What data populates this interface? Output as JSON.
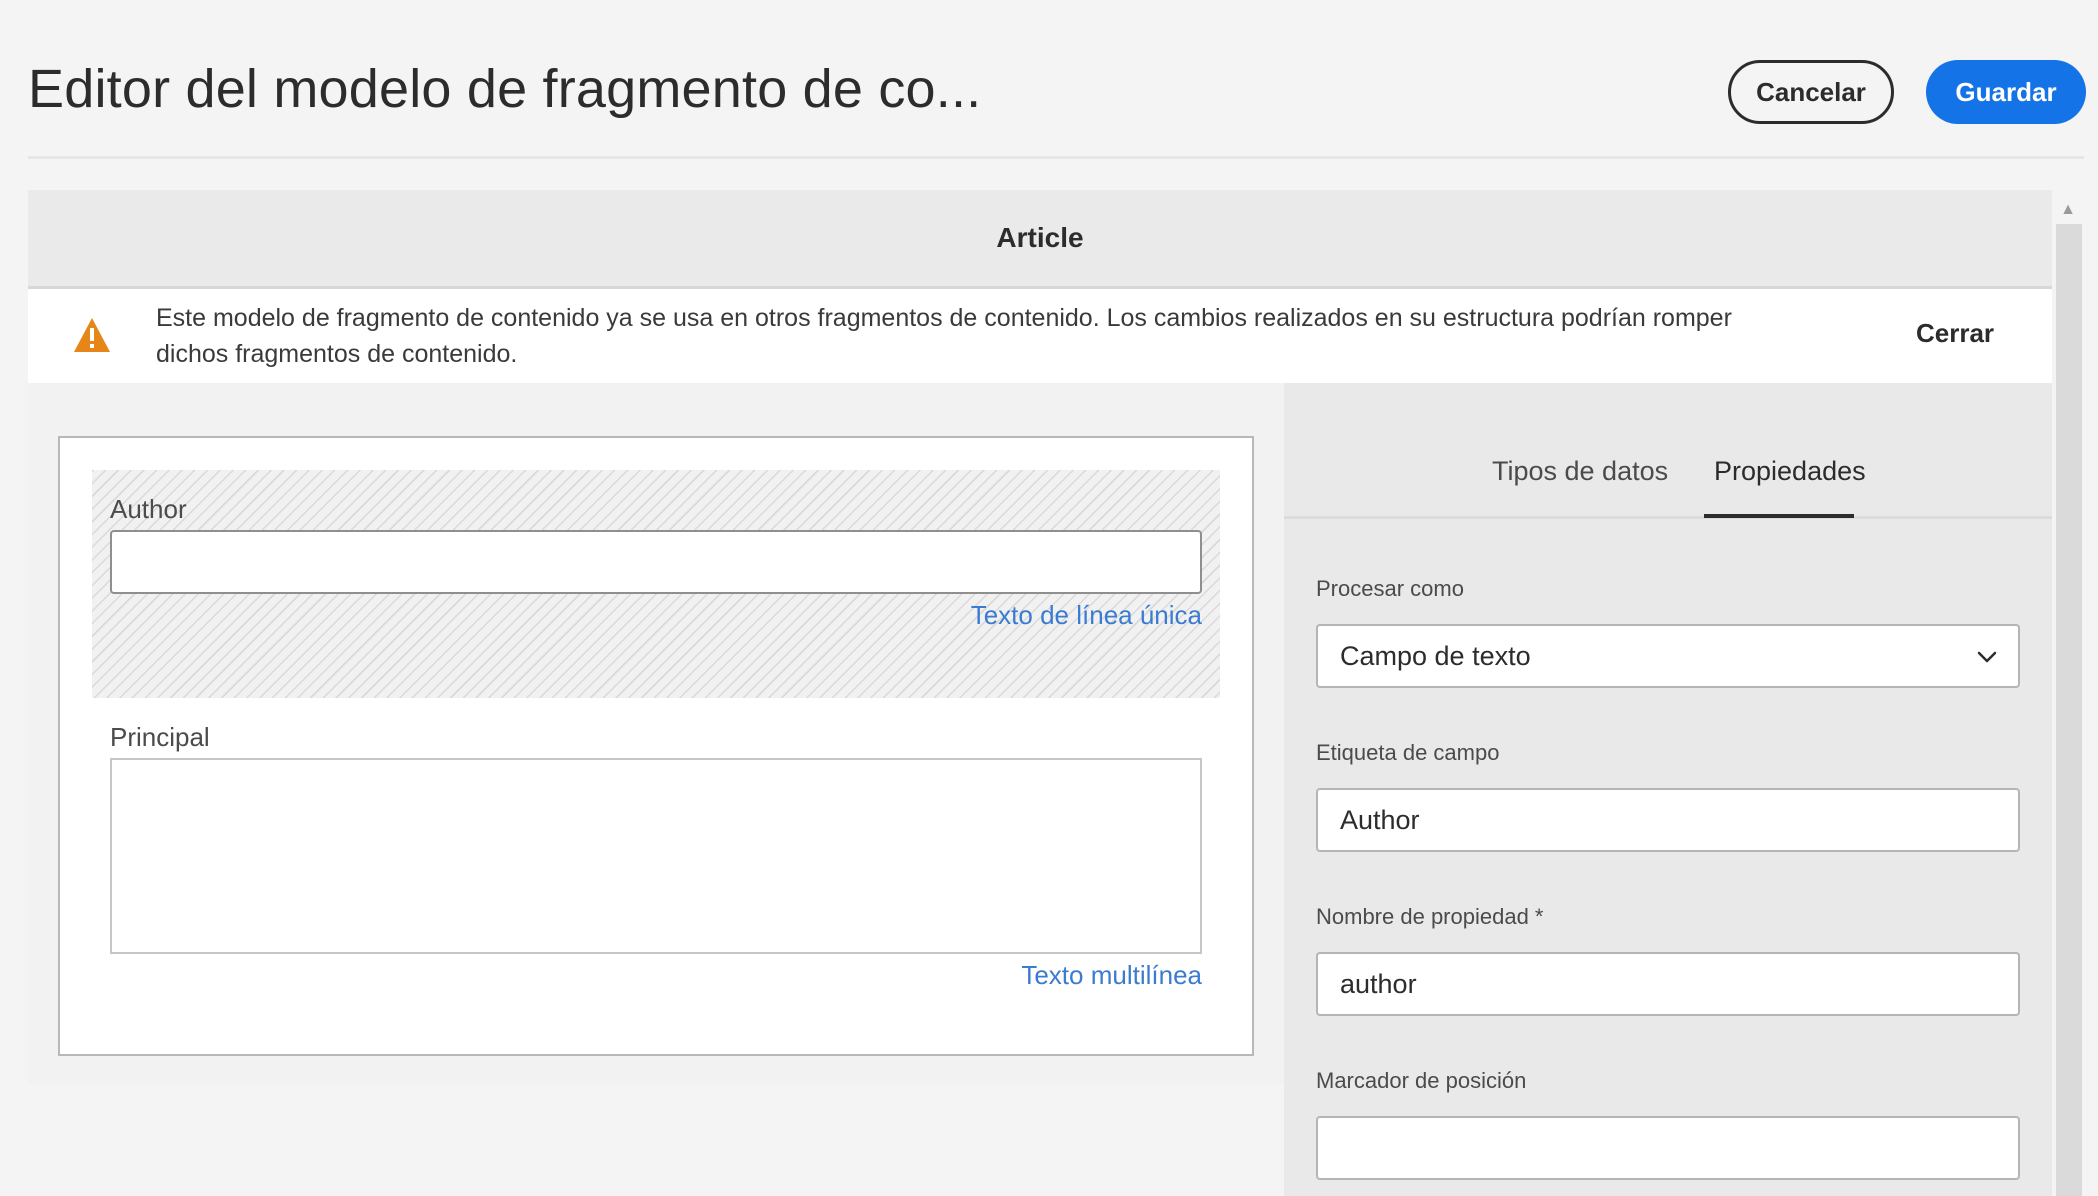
{
  "header": {
    "title": "Editor del modelo de fragmento de co...",
    "cancel_label": "Cancelar",
    "save_label": "Guardar"
  },
  "model": {
    "title": "Article"
  },
  "warning": {
    "text": "Este modelo de fragmento de contenido ya se usa en otros fragmentos de contenido. Los cambios realizados en su estructura podrían romper dichos fragmentos de contenido.",
    "close_label": "Cerrar",
    "icon": "alert-triangle-icon"
  },
  "canvas": {
    "fields": [
      {
        "label": "Author",
        "type_label": "Texto de línea única",
        "value": ""
      },
      {
        "label": "Principal",
        "type_label": "Texto multilínea",
        "value": ""
      }
    ]
  },
  "panel": {
    "tabs": [
      {
        "label": "Tipos de datos",
        "active": false
      },
      {
        "label": "Propiedades",
        "active": true
      }
    ],
    "render_as": {
      "label": "Procesar como",
      "value": "Campo de texto"
    },
    "field_label": {
      "label": "Etiqueta de campo",
      "value": "Author"
    },
    "property_name": {
      "label": "Nombre de propiedad *",
      "value": "author"
    },
    "placeholder": {
      "label": "Marcador de posición",
      "value": ""
    }
  },
  "colors": {
    "primary_button": "#1473e6",
    "warning_icon": "#e68619",
    "link_text": "#3b7bd1",
    "panel_bg": "#e9e9e9"
  }
}
